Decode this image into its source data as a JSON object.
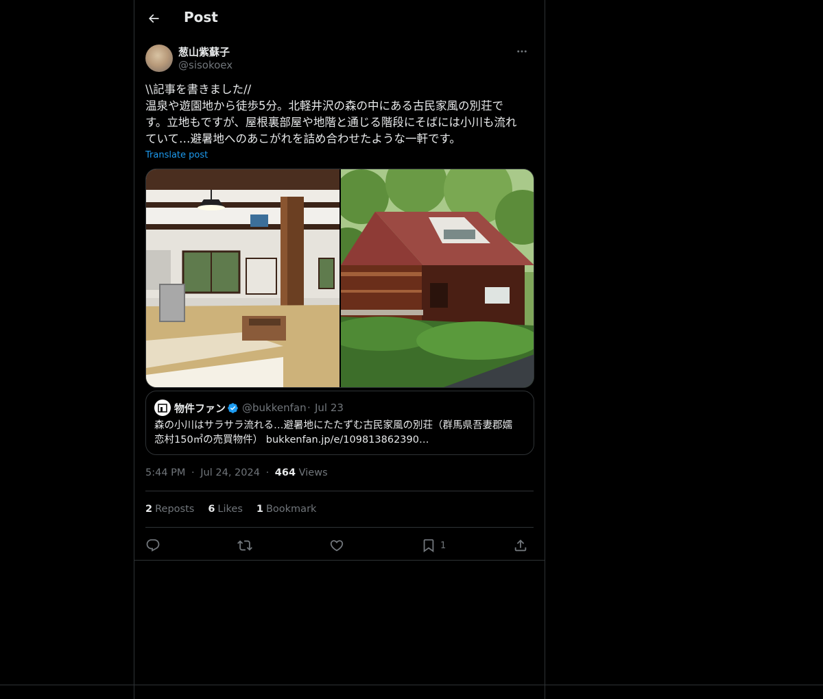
{
  "header": {
    "title": "Post"
  },
  "author": {
    "display_name": "葱山紫蘇子",
    "handle": "@sisokoex"
  },
  "post": {
    "lines": [
      "\\\\記事を書きました//",
      "温泉や遊園地から徒歩5分。北軽井沢の森の中にある古民家風の別荘で",
      "す。立地もですが、屋根裏部屋や地階と通じる階段にそばには小川も流れ",
      "ていて…避暑地へのあこがれを詰め合わせたような一軒です。"
    ],
    "translate_label": "Translate post"
  },
  "quote": {
    "name": "物件ファン",
    "handle": "@bukkenfan",
    "separator": "·",
    "date": "Jul 23",
    "lines": [
      "森の小川はサラサラ流れる…避暑地にたたずむ古民家風の別荘（群馬県吾妻郡嬬",
      "恋村150㎡の売買物件） bukkenfan.jp/e/109813862390…"
    ],
    "verified": true
  },
  "meta": {
    "time": "5:44 PM",
    "separator": "·",
    "date": "Jul 24, 2024",
    "views_count": "464",
    "views_label": "Views"
  },
  "stats": {
    "reposts_count": "2",
    "reposts_label": "Reposts",
    "likes_count": "6",
    "likes_label": "Likes",
    "bookmarks_count": "1",
    "bookmarks_label": "Bookmark"
  },
  "actions": {
    "bookmark_count": "1"
  },
  "colors": {
    "background": "#000000",
    "text": "#e7e9ea",
    "muted": "#71767b",
    "link": "#1d9bf0",
    "border": "#2f3336",
    "verified": "#1d9bf0"
  },
  "icons": [
    "back-arrow-icon",
    "more-icon",
    "verified-badge-icon",
    "reply-icon",
    "repost-icon",
    "like-icon",
    "bookmark-icon",
    "share-icon"
  ]
}
